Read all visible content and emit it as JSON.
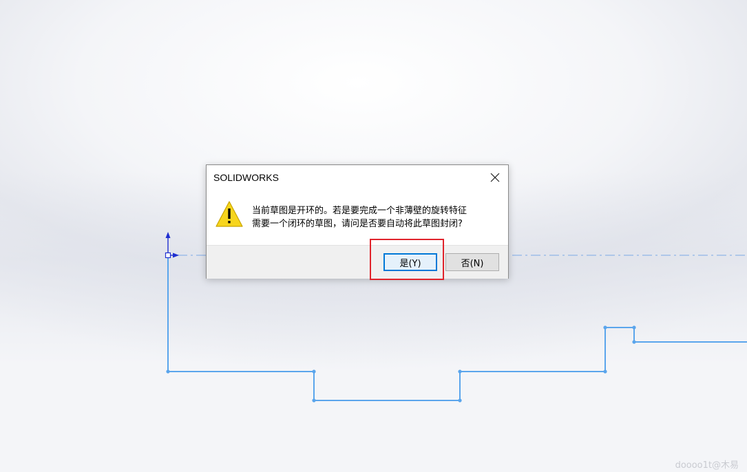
{
  "dialog": {
    "title": "SOLIDWORKS",
    "message_line1": "当前草图是开环的。若是要完成一个非薄壁的旋转特征",
    "message_line2": "需要一个闭环的草图，请问是否要自动将此草图封闭?",
    "yes_label": "是(Y)",
    "no_label": "否(N)",
    "warning_icon": "warning-icon",
    "close_icon": "close-icon"
  },
  "watermark": "doooo1t@木易",
  "colors": {
    "sketch_line": "#5aa5ec",
    "centerline": "#9dbde8",
    "axis_blue": "#1f2fd0",
    "highlight_red": "#e0232b",
    "warning_yellow": "#f7d51d"
  }
}
